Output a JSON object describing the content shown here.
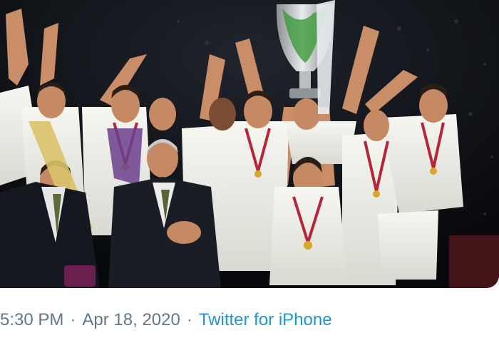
{
  "tweet": {
    "time": "5:30 PM",
    "date": "Apr 18, 2020",
    "separator": "·",
    "source": "Twitter for iPhone"
  },
  "photo": {
    "alt": ""
  },
  "colors": {
    "source_link": "#1b95e0",
    "meta_text": "#657786",
    "background": "#ffffff"
  }
}
